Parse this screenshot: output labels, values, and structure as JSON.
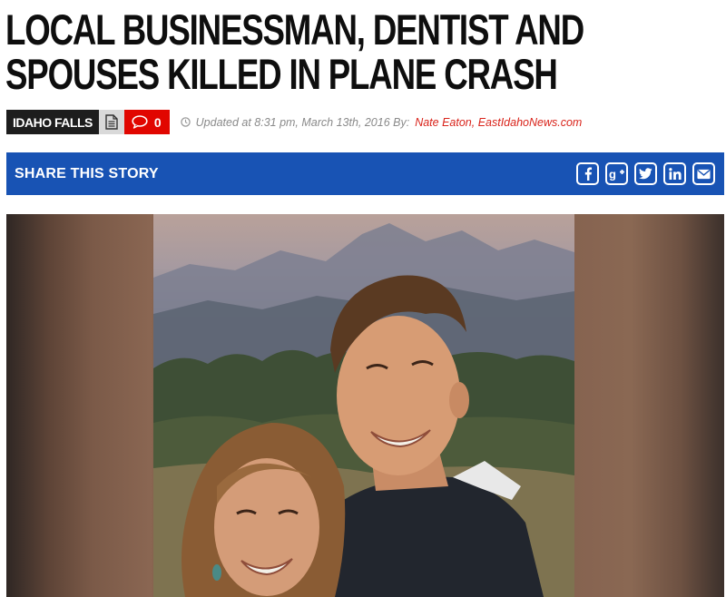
{
  "article": {
    "headline": "LOCAL BUSINESSMAN, DENTIST AND SPOUSES KILLED IN PLANE CRASH",
    "category": "IDAHO FALLS",
    "comment_count": "0",
    "updated_text": "Updated at 8:31 pm, March 13th, 2016 By:",
    "author": "Nate Eaton, EastIdahoNews.com"
  },
  "share": {
    "label": "SHARE THIS STORY",
    "icons": [
      "facebook-icon",
      "google-plus-icon",
      "twitter-icon",
      "linkedin-icon",
      "email-icon"
    ]
  },
  "colors": {
    "share_bar": "#1853b4",
    "comment_badge": "#e10600",
    "category_tag": "#1d1d1d",
    "author_link": "#d9241b"
  }
}
